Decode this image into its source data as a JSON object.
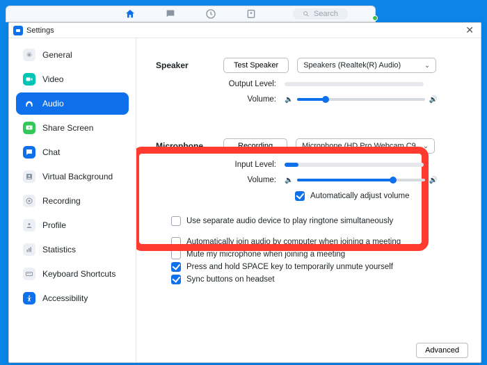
{
  "window": {
    "title": "Settings",
    "close_glyph": "✕"
  },
  "bgapp": {
    "search_placeholder": "Search"
  },
  "sidebar": {
    "items": [
      {
        "id": "general",
        "label": "General"
      },
      {
        "id": "video",
        "label": "Video"
      },
      {
        "id": "audio",
        "label": "Audio"
      },
      {
        "id": "share-screen",
        "label": "Share Screen"
      },
      {
        "id": "chat",
        "label": "Chat"
      },
      {
        "id": "virtual-background",
        "label": "Virtual Background"
      },
      {
        "id": "recording",
        "label": "Recording"
      },
      {
        "id": "profile",
        "label": "Profile"
      },
      {
        "id": "statistics",
        "label": "Statistics"
      },
      {
        "id": "keyboard-shortcuts",
        "label": "Keyboard Shortcuts"
      },
      {
        "id": "accessibility",
        "label": "Accessibility"
      }
    ],
    "selected": "audio"
  },
  "speaker": {
    "section_label": "Speaker",
    "test_button": "Test Speaker",
    "device_selected": "Speakers (Realtek(R) Audio)",
    "output_level_label": "Output Level:",
    "output_level_percent": 0,
    "volume_label": "Volume:",
    "volume_percent": 22
  },
  "microphone": {
    "section_label": "Microphone",
    "test_button": "Recording",
    "device_selected": "Microphone (HD Pro Webcam C9...",
    "input_level_label": "Input Level:",
    "input_level_percent": 10,
    "volume_label": "Volume:",
    "volume_percent": 75,
    "auto_adjust_label": "Automatically adjust volume",
    "auto_adjust_checked": true
  },
  "options": [
    {
      "label": "Use separate audio device to play ringtone simultaneously",
      "checked": false
    },
    {
      "label": "Automatically join audio by computer when joining a meeting",
      "checked": false
    },
    {
      "label": "Mute my microphone when joining a meeting",
      "checked": false
    },
    {
      "label": "Press and hold SPACE key to temporarily unmute yourself",
      "checked": true
    },
    {
      "label": "Sync buttons on headset",
      "checked": true
    }
  ],
  "footer": {
    "advanced_button": "Advanced"
  },
  "colors": {
    "accent": "#0e71eb",
    "highlight": "#ff3b2f"
  }
}
